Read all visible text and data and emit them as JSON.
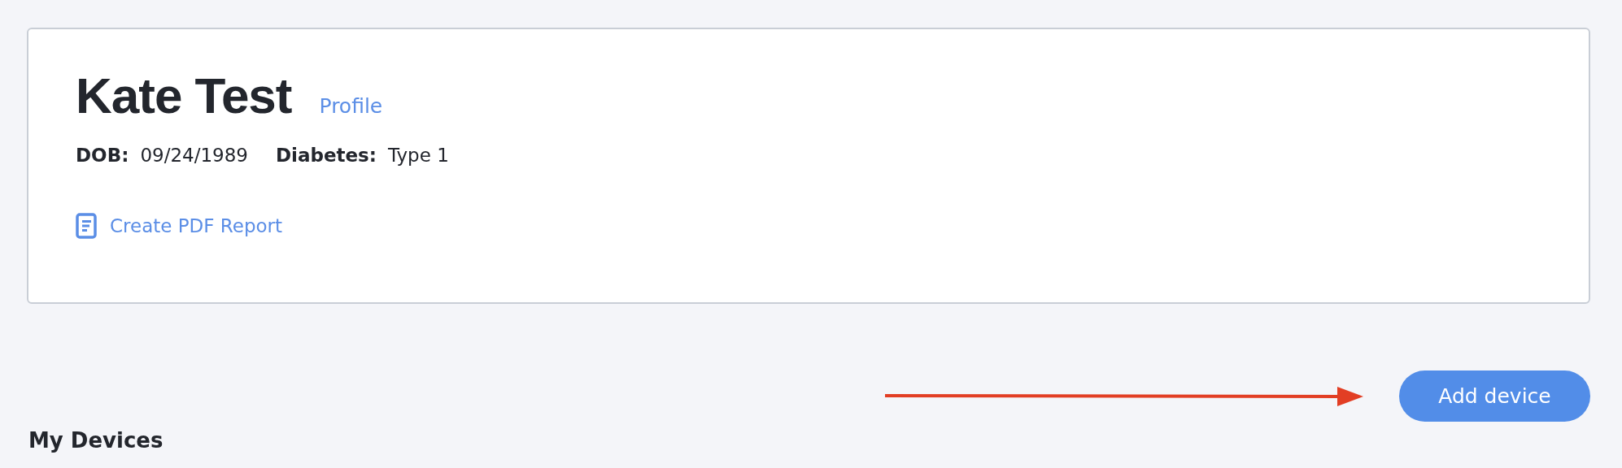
{
  "patient": {
    "name": "Kate Test",
    "profile_link": "Profile",
    "fields": [
      {
        "label": "DOB:",
        "value": "09/24/1989"
      },
      {
        "label": "Diabetes:",
        "value": "Type 1"
      }
    ],
    "report_link": "Create PDF Report"
  },
  "add_device_button": "Add device",
  "section_title": "My Devices"
}
